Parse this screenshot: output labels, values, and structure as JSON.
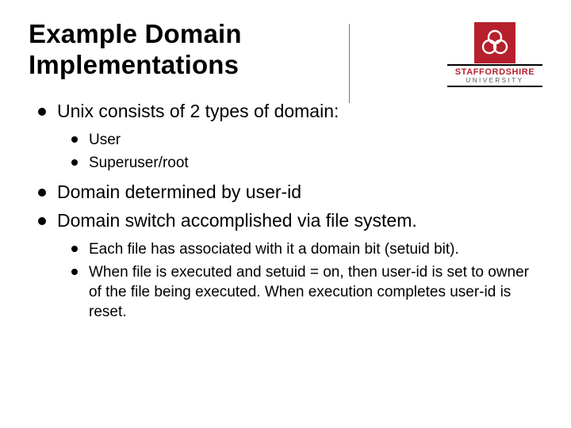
{
  "title": "Example Domain Implementations",
  "logo": {
    "name": "STAFFORDSHIRE",
    "sub": "UNIVERSITY"
  },
  "bullets": [
    {
      "text": "Unix consists of 2 types of domain:",
      "sub": [
        {
          "text": "User"
        },
        {
          "text": "Superuser/root"
        }
      ]
    },
    {
      "text": "Domain determined by user-id"
    },
    {
      "text": "Domain switch accomplished via file system.",
      "sub": [
        {
          "text": "Each file has associated with it a domain bit (setuid bit)."
        },
        {
          "text": "When file is executed and setuid = on, then user-id is set to owner of the file being executed. When execution completes user-id is reset."
        }
      ]
    }
  ]
}
